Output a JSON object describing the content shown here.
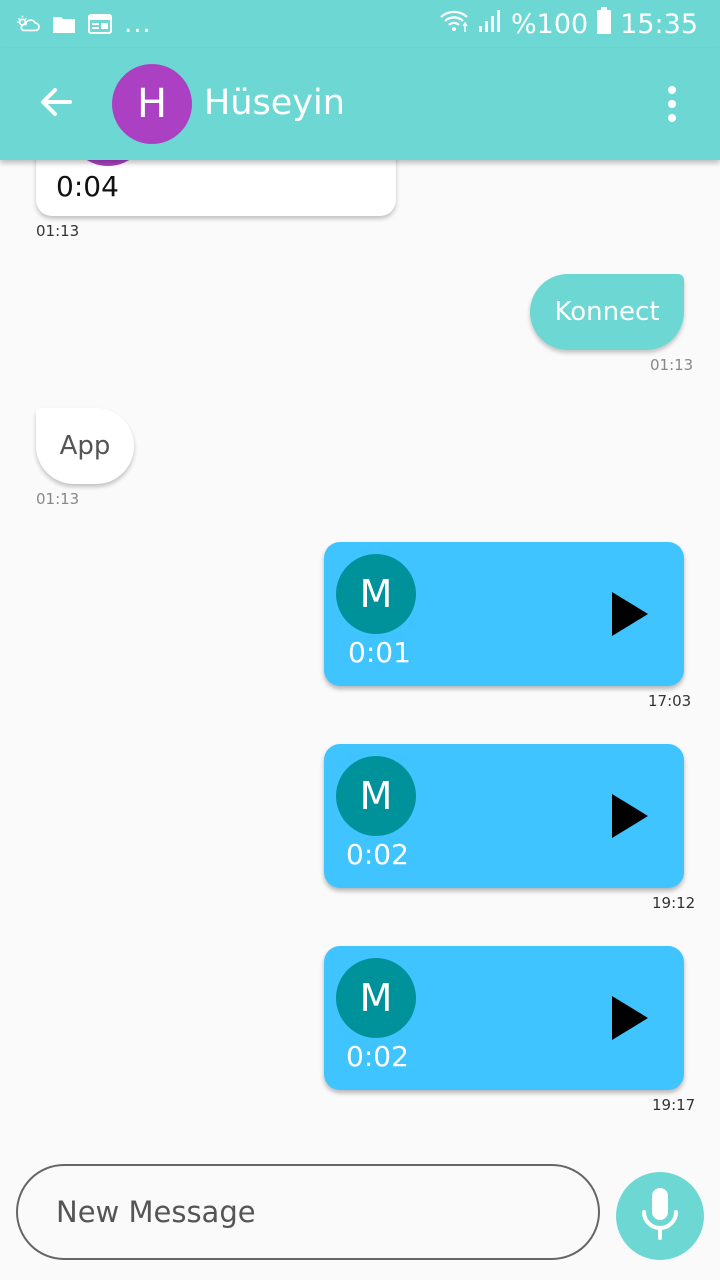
{
  "status_bar": {
    "left_icons": [
      "weather-icon",
      "folder-icon",
      "calendar-icon"
    ],
    "overflow": "...",
    "battery_text": "%100",
    "time": "15:35"
  },
  "header": {
    "back_icon": "arrow-left-icon",
    "avatar_letter": "H",
    "contact_name": "Hüseyin",
    "menu_icon": "more-vert-icon"
  },
  "messages": [
    {
      "type": "voice",
      "direction": "incoming",
      "duration": "0:04",
      "time": "01:13"
    },
    {
      "type": "text",
      "direction": "outgoing",
      "text": "Konnect",
      "time": "01:13"
    },
    {
      "type": "text",
      "direction": "incoming",
      "text": "App",
      "time": "01:13"
    },
    {
      "type": "voice",
      "direction": "outgoing",
      "avatar_letter": "M",
      "duration": "0:01",
      "time": "17:03"
    },
    {
      "type": "voice",
      "direction": "outgoing",
      "avatar_letter": "M",
      "duration": "0:02",
      "time": "19:12"
    },
    {
      "type": "voice",
      "direction": "outgoing",
      "avatar_letter": "M",
      "duration": "0:02",
      "time": "19:17"
    }
  ],
  "composer": {
    "placeholder": "New Message",
    "value": "",
    "mic_icon": "microphone-icon"
  },
  "colors": {
    "primary": "#6dd8d3",
    "outgoing_voice": "#40c4ff",
    "voice_avatar": "#00929b",
    "contact_avatar": "#ab40c3",
    "background": "#fafafa"
  }
}
